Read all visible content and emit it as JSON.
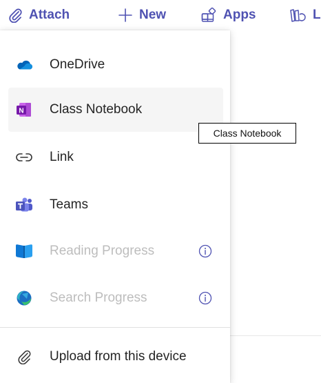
{
  "toolbar": {
    "attach_label": "Attach",
    "new_label": "New",
    "apps_label": "Apps",
    "cut_label": "L",
    "accent_color": "#4f52b2"
  },
  "menu": {
    "items": [
      {
        "label": "OneDrive",
        "icon": "onedrive-icon"
      },
      {
        "label": "Class Notebook",
        "icon": "onenote-icon"
      },
      {
        "label": "Link",
        "icon": "link-icon"
      },
      {
        "label": "Teams",
        "icon": "teams-icon"
      },
      {
        "label": "Reading Progress",
        "icon": "reading-progress-icon",
        "disabled": true
      },
      {
        "label": "Search Progress",
        "icon": "search-progress-icon",
        "disabled": true
      }
    ],
    "upload_label": "Upload from this device"
  },
  "tooltip": {
    "text": "Class Notebook"
  }
}
